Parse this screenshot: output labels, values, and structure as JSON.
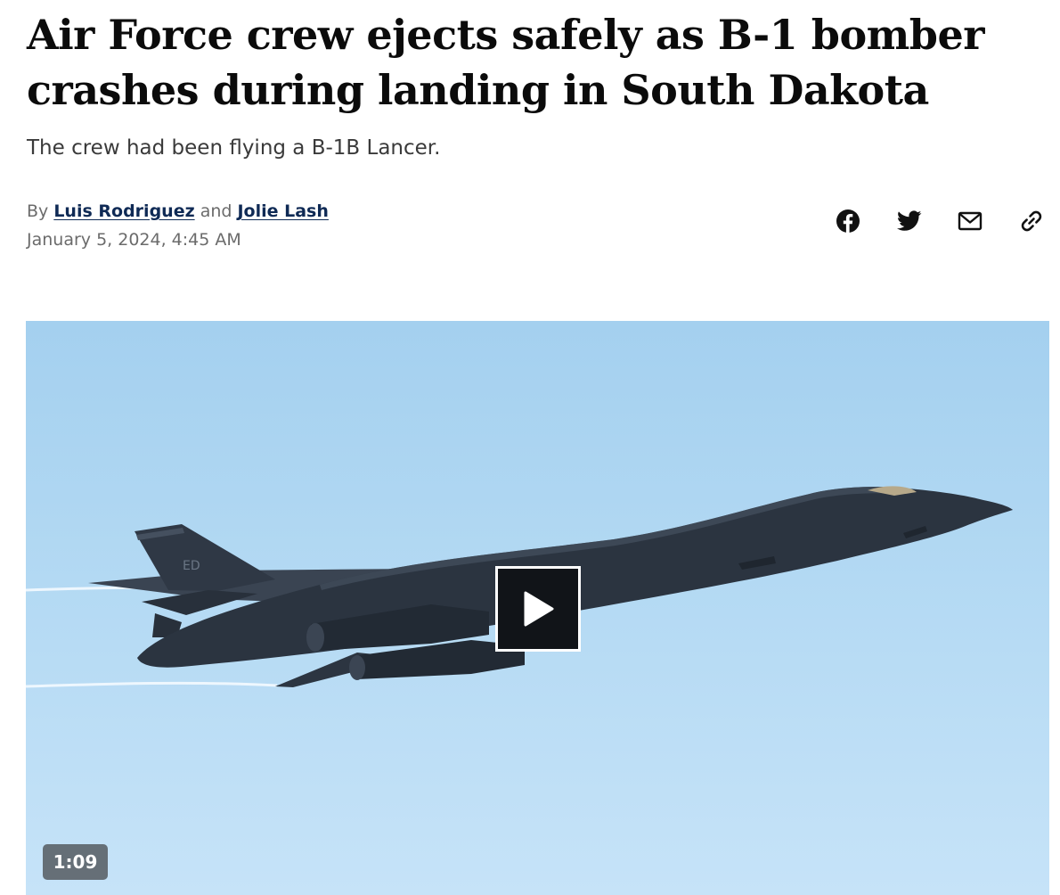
{
  "article": {
    "headline": "Air Force crew ejects safely as B-1 bomber crashes during landing in South Dakota",
    "dek": "The crew had been flying a B-1B Lancer.",
    "byline": {
      "prefix": "By",
      "author1": "Luis Rodriguez",
      "conjunction": "and",
      "author2": "Jolie Lash"
    },
    "date": "January 5, 2024, 4:45 AM"
  },
  "share": {
    "icons": [
      "facebook-icon",
      "twitter-icon",
      "email-icon",
      "link-icon"
    ]
  },
  "video": {
    "duration": "1:09",
    "play_icon": "play-icon",
    "sky_color": "#b3d9f3",
    "aircraft_color": "#2b3440"
  },
  "colors": {
    "author_link": "#0f2a55",
    "meta_text": "#6b6b6b"
  }
}
